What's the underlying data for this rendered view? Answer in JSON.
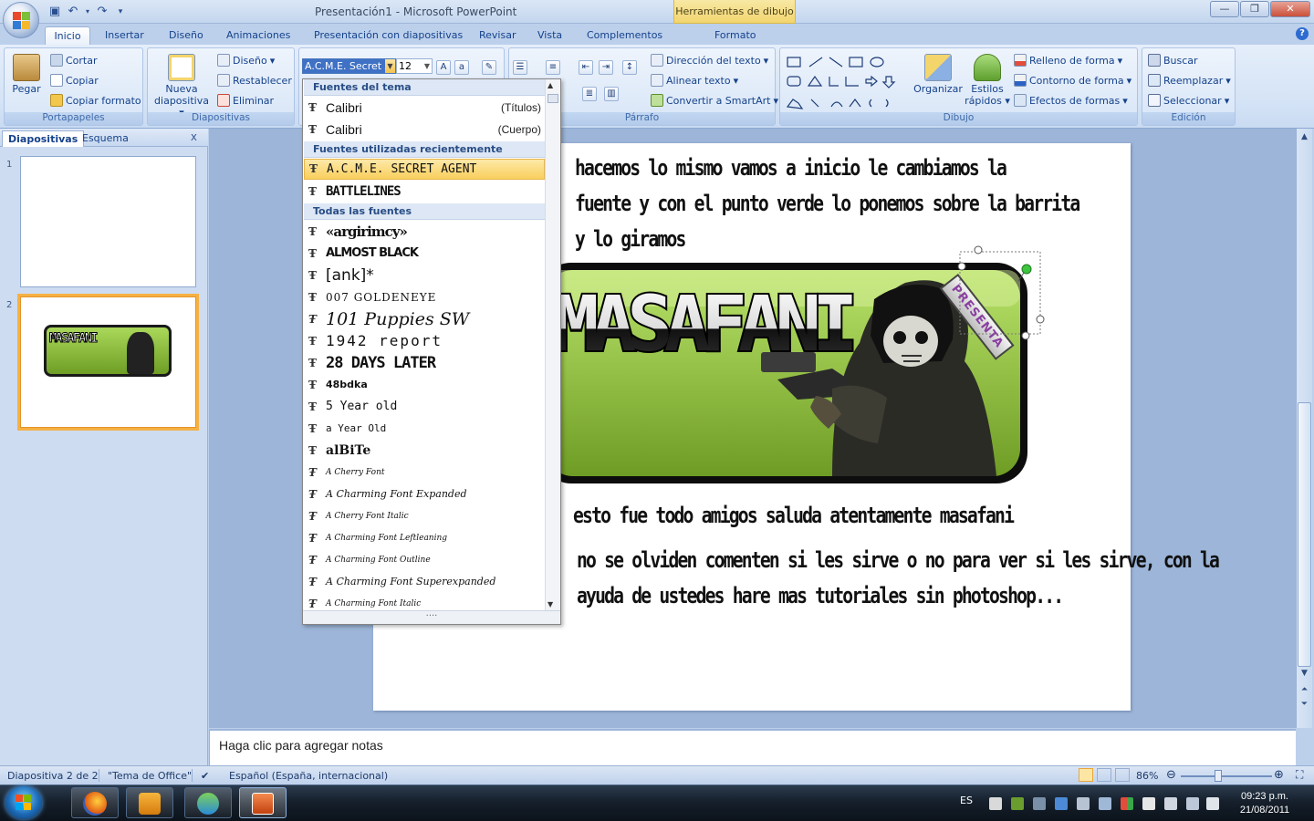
{
  "window": {
    "title": "Presentación1 - Microsoft PowerPoint",
    "context_title": "Herramientas de dibujo"
  },
  "tabs": [
    "Inicio",
    "Insertar",
    "Diseño",
    "Animaciones",
    "Presentación con diapositivas",
    "Revisar",
    "Vista",
    "Complementos",
    "Formato"
  ],
  "ribbon": {
    "portapapeles": {
      "label": "Portapapeles",
      "paste": "Pegar",
      "cut": "Cortar",
      "copy": "Copiar",
      "format_painter": "Copiar formato"
    },
    "diapositivas": {
      "label": "Diapositivas",
      "new_slide_1": "Nueva",
      "new_slide_2": "diapositiva",
      "layout": "Diseño",
      "reset": "Restablecer",
      "delete": "Eliminar"
    },
    "fuente": {
      "font_value": "A.C.M.E. Secret A",
      "size_value": "12"
    },
    "parrafo": {
      "label": "Párrafo",
      "text_direction": "Dirección del texto",
      "align_text": "Alinear texto",
      "smartart": "Convertir a SmartArt"
    },
    "dibujo": {
      "label": "Dibujo",
      "arrange": "Organizar",
      "styles_1": "Estilos",
      "styles_2": "rápidos",
      "fill": "Relleno de forma",
      "outline": "Contorno de forma",
      "effects": "Efectos de formas"
    },
    "edicion": {
      "label": "Edición",
      "find": "Buscar",
      "replace": "Reemplazar",
      "select": "Seleccionar"
    }
  },
  "left_panel": {
    "tab_slides": "Diapositivas",
    "tab_outline": "Esquema",
    "close": "x",
    "slide_numbers": [
      "1",
      "2"
    ],
    "thumb_banner": "MASAFANI"
  },
  "font_dropdown": {
    "section_theme": "Fuentes del tema",
    "theme_fonts": [
      {
        "name": "Calibri",
        "note": "(Títulos)"
      },
      {
        "name": "Calibri",
        "note": "(Cuerpo)"
      }
    ],
    "section_recent": "Fuentes utilizadas recientemente",
    "recent_fonts": [
      "A.C.M.E. SECRET AGENT",
      "BATTLELINES"
    ],
    "section_all": "Todas las fuentes",
    "all_fonts": [
      "«argirimcy»",
      "ALMOST BLACK",
      "[ank]*",
      "007 GOLDENEYE",
      "101 Puppies SW",
      "1942 report",
      "28 DAYS LATER",
      "48bdka",
      "5 Year old",
      "a Year Old",
      "alBiTe",
      "A Cherry Font",
      "A Charming Font Expanded",
      "A Cherry Font Italic",
      "A Charming Font Leftleaning",
      "A Charming Font Outline",
      "A Charming Font Superexpanded",
      "A Charming Font Italic"
    ]
  },
  "slide": {
    "line1": "hacemos lo mismo vamos a inicio le cambiamos la",
    "line2": "fuente y con el punto verde lo ponemos sobre la barrita",
    "line3": "y lo giramos",
    "banner_text": "MASAFANI",
    "ribbon_label": "PRESENTA",
    "line4": "esto fue todo amigos saluda atentamente masafani",
    "line5": "no se olviden comenten si les sirve o no para ver si les sirve, con la",
    "line6": "ayuda de ustedes hare mas tutoriales sin photoshop..."
  },
  "notes": {
    "placeholder": "Haga clic para agregar notas"
  },
  "status": {
    "slide_info": "Diapositiva 2 de 2",
    "theme": "\"Tema de Office\"",
    "language": "Español (España, internacional)",
    "zoom": "86%"
  },
  "taskbar": {
    "lang": "ES",
    "time": "09:23 p.m.",
    "date": "21/08/2011"
  },
  "colors": {
    "ribbon_blue": "#15428b",
    "banner_green": "#8fc230",
    "selection_orange": "#f5b143"
  }
}
